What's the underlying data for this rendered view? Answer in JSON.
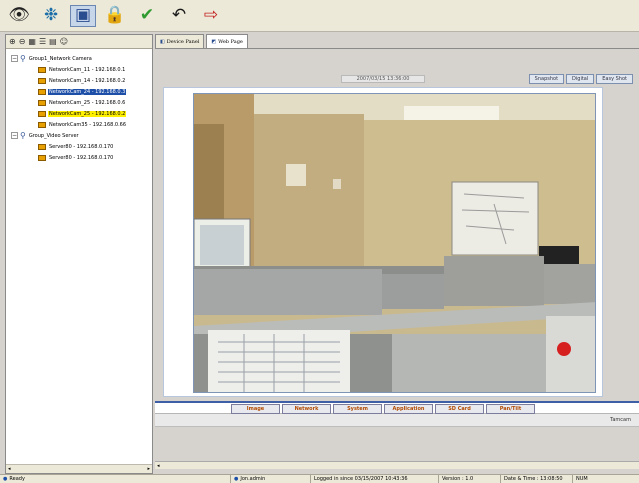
{
  "toolbar": {
    "buttons": [
      {
        "icon": "eye-icon",
        "glyph": "👁",
        "color": "#222222"
      },
      {
        "icon": "network-icon",
        "glyph": "❉",
        "color": "#1b6ea8"
      },
      {
        "icon": "camera-view-icon",
        "glyph": "▣",
        "color": "#2a4d8f"
      },
      {
        "icon": "lock-icon",
        "glyph": "🔒",
        "color": "#2c58b0"
      },
      {
        "icon": "checkmark-icon",
        "glyph": "✔",
        "color": "#2f9a2f"
      },
      {
        "icon": "undo-arrow-icon",
        "glyph": "↶",
        "color": "#1a1a1a"
      },
      {
        "icon": "exit-icon",
        "glyph": "⇨",
        "color": "#c22020"
      }
    ]
  },
  "left_tools": [
    "add-group-icon",
    "remove-group-icon",
    "grid-icon",
    "list-icon",
    "properties-icon",
    "users-icon"
  ],
  "tree": {
    "group1": {
      "label": "Group1_Network Camera"
    },
    "cameras": [
      {
        "label": "NetworkCam_11 - 192.168.0.1",
        "state": ""
      },
      {
        "label": "NetworkCam_14 - 192.168.0.2",
        "state": ""
      },
      {
        "label": "NetworkCam_24 - 192.168.0.3",
        "state": "selected-blue"
      },
      {
        "label": "NetworkCam_25 - 192.168.0.6",
        "state": ""
      },
      {
        "label": "NetworkCam_25 - 192.168.0.2",
        "state": "selected-yellow"
      },
      {
        "label": "NetworkCam35 - 192.168.0.66",
        "state": ""
      }
    ],
    "group2": {
      "label": "Group_Video Server"
    },
    "servers": [
      {
        "label": "Server80 - 192.168.0.170",
        "state": ""
      },
      {
        "label": "Server80 - 192.168.0.170",
        "state": ""
      }
    ]
  },
  "tabs": [
    {
      "label": "Device Panel",
      "active": false
    },
    {
      "label": "Web Page",
      "active": true
    }
  ],
  "webpage": {
    "timestamp": "2007/03/15 13:36:00",
    "view_buttons": [
      "Snapshot",
      "Digital",
      "Easy Shot"
    ],
    "nav_buttons": [
      "Image",
      "Network",
      "System",
      "Application",
      "SD Card",
      "Pan/Tilt"
    ],
    "camera_name": "Tamcam"
  },
  "statusbar": {
    "ready": "Ready",
    "user": "Jon.admin",
    "logged": "Logged in since 03/15/2007 10:43:36",
    "version": "Version : 1.0",
    "datetime": "Date & Time : 13:08:50",
    "indicator": "NUM"
  }
}
